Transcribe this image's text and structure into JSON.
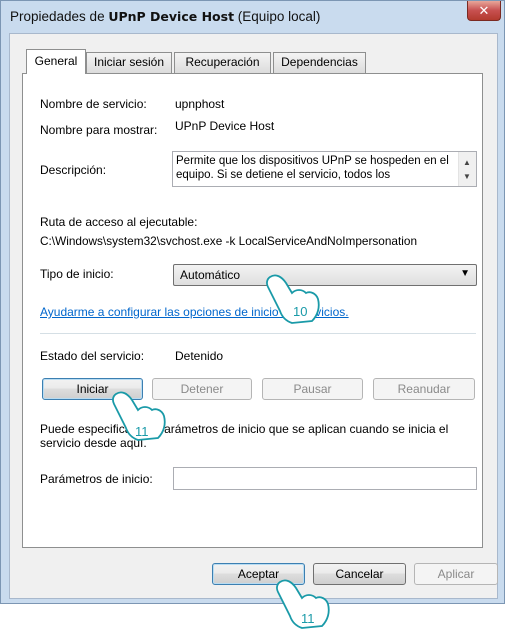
{
  "window": {
    "title_prefix": "Propiedades de ",
    "title_service": "UPnP Device Host",
    "title_suffix": " (Equipo local)",
    "close_label": "✕"
  },
  "tabs": [
    {
      "label": "General",
      "active": true
    },
    {
      "label": "Iniciar sesión",
      "active": false
    },
    {
      "label": "Recuperación",
      "active": false
    },
    {
      "label": "Dependencias",
      "active": false
    }
  ],
  "general": {
    "service_name_label": "Nombre de servicio:",
    "service_name_value": "upnphost",
    "display_name_label": "Nombre para mostrar:",
    "display_name_value": "UPnP Device Host",
    "description_label": "Descripción:",
    "description_value": "Permite que los dispositivos UPnP se hospeden en el equipo. Si se detiene el servicio, todos los",
    "path_label": "Ruta de acceso al ejecutable:",
    "path_value": "C:\\Windows\\system32\\svchost.exe -k LocalServiceAndNoImpersonation",
    "startup_type_label": "Tipo de inicio:",
    "startup_type_value": "Automático",
    "help_link": "Ayudarme a configurar las opciones de inicio de servicios.",
    "status_label": "Estado del servicio:",
    "status_value": "Detenido",
    "start_button": "Iniciar",
    "stop_button": "Detener",
    "pause_button": "Pausar",
    "resume_button": "Reanudar",
    "params_info": "Puede especificar los parámetros de inicio que se aplican cuando se inicia el servicio desde aquí.",
    "params_label": "Parámetros de inicio:",
    "params_value": ""
  },
  "footer": {
    "ok_button": "Aceptar",
    "cancel_button": "Cancelar",
    "apply_button": "Aplicar"
  },
  "annotations": {
    "step_startup": "10",
    "step_start": "11",
    "step_accept": "11"
  }
}
